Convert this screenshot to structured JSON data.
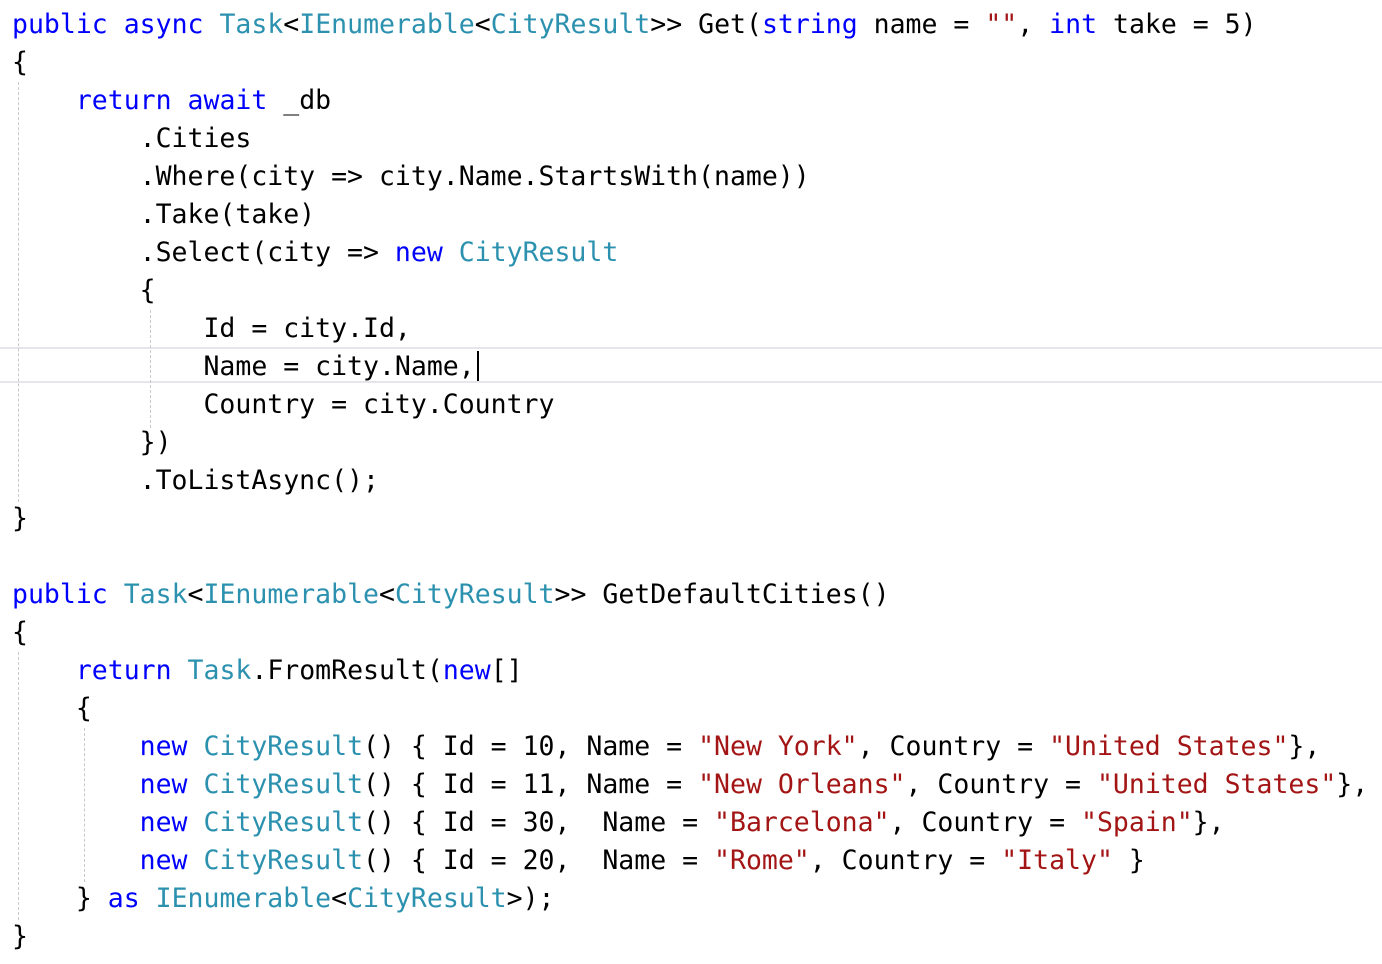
{
  "editor": {
    "lines": [
      [
        {
          "t": "public",
          "c": "kw"
        },
        {
          "t": " ",
          "c": "pl"
        },
        {
          "t": "async",
          "c": "kw"
        },
        {
          "t": " ",
          "c": "pl"
        },
        {
          "t": "Task",
          "c": "ty"
        },
        {
          "t": "<",
          "c": "pl"
        },
        {
          "t": "IEnumerable",
          "c": "ty"
        },
        {
          "t": "<",
          "c": "pl"
        },
        {
          "t": "CityResult",
          "c": "ty"
        },
        {
          "t": ">> Get(",
          "c": "pl"
        },
        {
          "t": "string",
          "c": "kw"
        },
        {
          "t": " name = ",
          "c": "pl"
        },
        {
          "t": "\"\"",
          "c": "st"
        },
        {
          "t": ", ",
          "c": "pl"
        },
        {
          "t": "int",
          "c": "kw"
        },
        {
          "t": " take = 5)",
          "c": "pl"
        }
      ],
      [
        {
          "t": "{",
          "c": "pl"
        }
      ],
      [
        {
          "t": "    ",
          "c": "pl"
        },
        {
          "t": "return",
          "c": "kw"
        },
        {
          "t": " ",
          "c": "pl"
        },
        {
          "t": "await",
          "c": "kw"
        },
        {
          "t": " _db",
          "c": "pl"
        }
      ],
      [
        {
          "t": "        .Cities",
          "c": "pl"
        }
      ],
      [
        {
          "t": "        .Where(city => city.Name.StartsWith(name))",
          "c": "pl"
        }
      ],
      [
        {
          "t": "        .Take(take)",
          "c": "pl"
        }
      ],
      [
        {
          "t": "        .Select(city => ",
          "c": "pl"
        },
        {
          "t": "new",
          "c": "kw"
        },
        {
          "t": " ",
          "c": "pl"
        },
        {
          "t": "CityResult",
          "c": "ty"
        }
      ],
      [
        {
          "t": "        {",
          "c": "pl"
        }
      ],
      [
        {
          "t": "            Id = city.Id,",
          "c": "pl"
        }
      ],
      [
        {
          "t": "            Name = city.Name,",
          "c": "pl"
        }
      ],
      [
        {
          "t": "            Country = city.Country",
          "c": "pl"
        }
      ],
      [
        {
          "t": "        })",
          "c": "pl"
        }
      ],
      [
        {
          "t": "        .ToListAsync();",
          "c": "pl"
        }
      ],
      [
        {
          "t": "}",
          "c": "pl"
        }
      ],
      [],
      [
        {
          "t": "public",
          "c": "kw"
        },
        {
          "t": " ",
          "c": "pl"
        },
        {
          "t": "Task",
          "c": "ty"
        },
        {
          "t": "<",
          "c": "pl"
        },
        {
          "t": "IEnumerable",
          "c": "ty"
        },
        {
          "t": "<",
          "c": "pl"
        },
        {
          "t": "CityResult",
          "c": "ty"
        },
        {
          "t": ">> GetDefaultCities()",
          "c": "pl"
        }
      ],
      [
        {
          "t": "{",
          "c": "pl"
        }
      ],
      [
        {
          "t": "    ",
          "c": "pl"
        },
        {
          "t": "return",
          "c": "kw"
        },
        {
          "t": " ",
          "c": "pl"
        },
        {
          "t": "Task",
          "c": "ty"
        },
        {
          "t": ".FromResult(",
          "c": "pl"
        },
        {
          "t": "new",
          "c": "kw"
        },
        {
          "t": "[]",
          "c": "pl"
        }
      ],
      [
        {
          "t": "    {",
          "c": "pl"
        }
      ],
      [
        {
          "t": "        ",
          "c": "pl"
        },
        {
          "t": "new",
          "c": "kw"
        },
        {
          "t": " ",
          "c": "pl"
        },
        {
          "t": "CityResult",
          "c": "ty"
        },
        {
          "t": "() { Id = 10, Name = ",
          "c": "pl"
        },
        {
          "t": "\"New York\"",
          "c": "st"
        },
        {
          "t": ", Country = ",
          "c": "pl"
        },
        {
          "t": "\"United States\"",
          "c": "st"
        },
        {
          "t": "},",
          "c": "pl"
        }
      ],
      [
        {
          "t": "        ",
          "c": "pl"
        },
        {
          "t": "new",
          "c": "kw"
        },
        {
          "t": " ",
          "c": "pl"
        },
        {
          "t": "CityResult",
          "c": "ty"
        },
        {
          "t": "() { Id = 11, Name = ",
          "c": "pl"
        },
        {
          "t": "\"New Orleans\"",
          "c": "st"
        },
        {
          "t": ", Country = ",
          "c": "pl"
        },
        {
          "t": "\"United States\"",
          "c": "st"
        },
        {
          "t": "},",
          "c": "pl"
        }
      ],
      [
        {
          "t": "        ",
          "c": "pl"
        },
        {
          "t": "new",
          "c": "kw"
        },
        {
          "t": " ",
          "c": "pl"
        },
        {
          "t": "CityResult",
          "c": "ty"
        },
        {
          "t": "() { Id = 30,  Name = ",
          "c": "pl"
        },
        {
          "t": "\"Barcelona\"",
          "c": "st"
        },
        {
          "t": ", Country = ",
          "c": "pl"
        },
        {
          "t": "\"Spain\"",
          "c": "st"
        },
        {
          "t": "},",
          "c": "pl"
        }
      ],
      [
        {
          "t": "        ",
          "c": "pl"
        },
        {
          "t": "new",
          "c": "kw"
        },
        {
          "t": " ",
          "c": "pl"
        },
        {
          "t": "CityResult",
          "c": "ty"
        },
        {
          "t": "() { Id = 20,  Name = ",
          "c": "pl"
        },
        {
          "t": "\"Rome\"",
          "c": "st"
        },
        {
          "t": ", Country = ",
          "c": "pl"
        },
        {
          "t": "\"Italy\"",
          "c": "st"
        },
        {
          "t": " }",
          "c": "pl"
        }
      ],
      [
        {
          "t": "    } ",
          "c": "pl"
        },
        {
          "t": "as",
          "c": "kw"
        },
        {
          "t": " ",
          "c": "pl"
        },
        {
          "t": "IEnumerable",
          "c": "ty"
        },
        {
          "t": "<",
          "c": "pl"
        },
        {
          "t": "CityResult",
          "c": "ty"
        },
        {
          "t": ">);",
          "c": "pl"
        }
      ],
      [
        {
          "t": "}",
          "c": "pl"
        }
      ]
    ]
  },
  "colors": {
    "keyword": "#0000ff",
    "type": "#2b91af",
    "string": "#a31515",
    "plain": "#000000",
    "background": "#ffffff"
  }
}
